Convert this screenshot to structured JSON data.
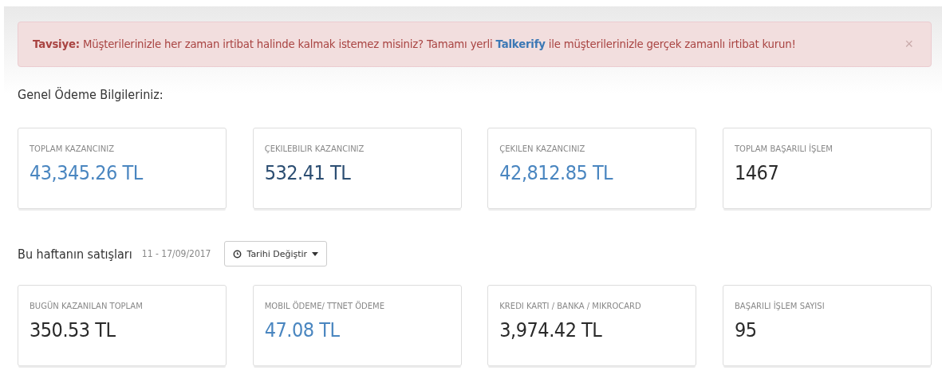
{
  "alert": {
    "text_before": "**Tavsiye:** Müşterilerinizle her zaman irtibat halinde kalmak istemez misiniz? Tamamı yerli",
    "link": "Talkerify",
    "text_after": "ile müşterilerinizle gerçek zamanlı irtibat kurun!",
    "close": "×"
  },
  "general": {
    "heading": "Genel Ödeme Bilgileriniz:",
    "cards": [
      {
        "label": "TOPLAM KAZANCINIZ",
        "value": "43,345.26 TL",
        "kind": "blue"
      },
      {
        "label": "ÇEKILEBILIR KAZANCINIZ",
        "value": "532.41 TL",
        "kind": "navy"
      },
      {
        "label": "ÇEKILEN KAZANCINIZ",
        "value": "42,812.85 TL",
        "kind": "blue"
      },
      {
        "label": "TOPLAM BAŞARILI İŞLEM",
        "value": "1467",
        "kind": "dark"
      }
    ]
  },
  "weekly": {
    "heading": "Bu haftanın satışları",
    "date_range": "11 - 17/09/2017",
    "button": "Tarihi Değiştir",
    "cards": [
      {
        "label": "BUGÜN KAZANILAN TOPLAM",
        "value": "350.53 TL",
        "kind": "dark"
      },
      {
        "label": "MOBIL ÖDEME/ TTNET ÖDEME",
        "value": "47.08 TL",
        "kind": "blue"
      },
      {
        "label": "KREDI KARTI / BANKA / MIKROCARD",
        "value": "3,974.42 TL",
        "kind": "dark"
      },
      {
        "label": "BAŞARILI İŞLEM SAYISI",
        "value": "95",
        "kind": "dark"
      }
    ]
  }
}
